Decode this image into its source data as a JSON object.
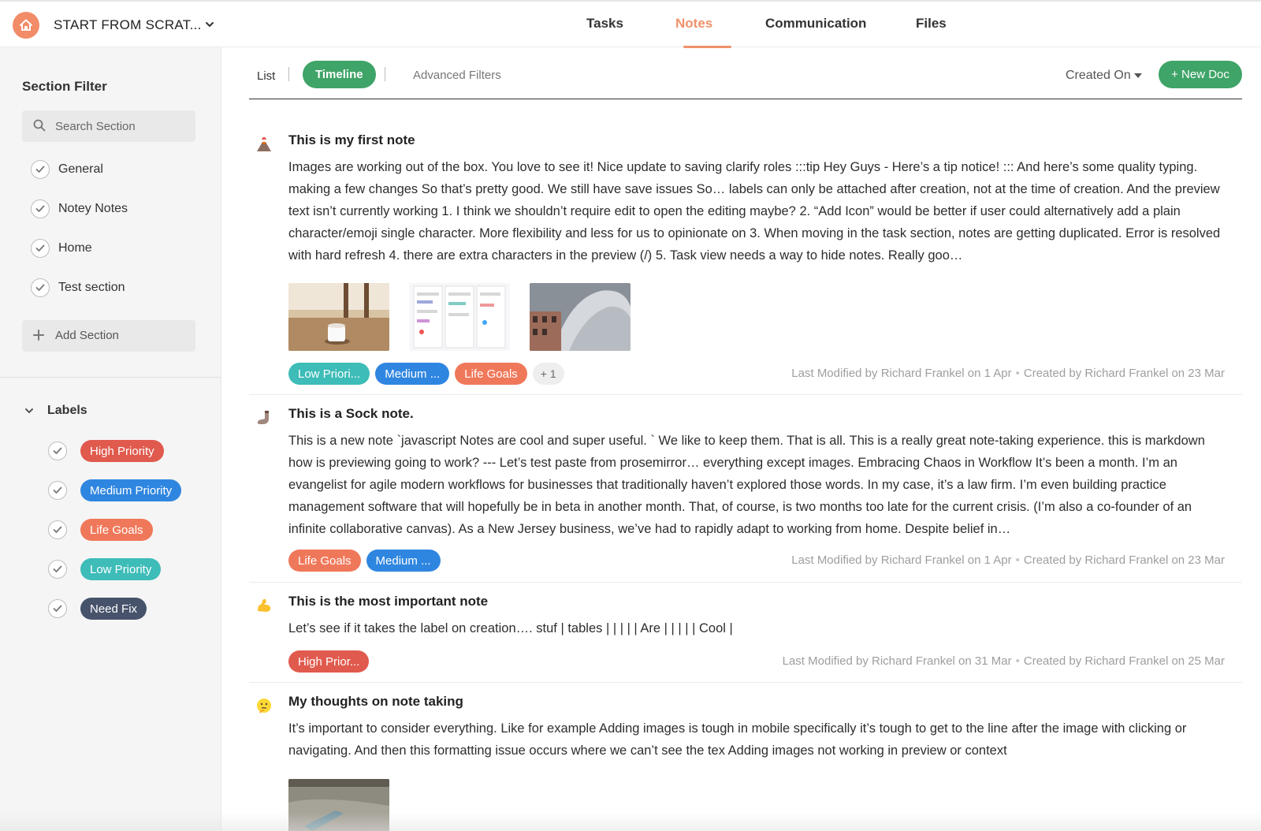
{
  "project": {
    "title": "START FROM SCRAT..."
  },
  "nav": {
    "tabs": [
      {
        "label": "Tasks",
        "active": false
      },
      {
        "label": "Notes",
        "active": true
      },
      {
        "label": "Communication",
        "active": false
      },
      {
        "label": "Files",
        "active": false
      }
    ]
  },
  "sidebar": {
    "section_filter_title": "Section Filter",
    "search_placeholder": "Search Section",
    "sections": [
      "General",
      "Notey Notes",
      "Home",
      "Test section"
    ],
    "add_section_label": "Add Section",
    "labels_title": "Labels",
    "labels": [
      {
        "name": "High Priority",
        "color": "#e05a4e"
      },
      {
        "name": "Medium Priority",
        "color": "#2f86e0"
      },
      {
        "name": "Life Goals",
        "color": "#f0785a"
      },
      {
        "name": "Low Priority",
        "color": "#3dbcb8"
      },
      {
        "name": "Need Fix",
        "color": "#46536a"
      }
    ]
  },
  "toolbar": {
    "list_label": "List",
    "timeline_label": "Timeline",
    "advanced_filters_label": "Advanced Filters",
    "sort_label": "Created On",
    "new_doc_label": "+ New Doc"
  },
  "notes": [
    {
      "icon": "volcano-icon",
      "title": "This is my first note",
      "body": "Images are working out of the box. You love to see it! Nice update to saving clarify roles :::tip Hey Guys - Here’s a tip notice! ::: And here’s some quality typing. making a few changes So that’s pretty good. We still have save issues So… labels can only be attached after creation, not at the time of creation. And the preview text isn’t currently working 1. I think we shouldn’t require edit to open the editing maybe? 2. “Add Icon” would be better if user could alternatively add a plain character/emoji single character. More flexibility and less for us to opinionate on 3. When moving in the task section, notes are getting duplicated. Error is resolved with hard refresh 4. there are extra characters in the preview (/) 5. Task view needs a way to hide notes. Really goo…",
      "images": [
        "coffee-cup-photo",
        "task-board-screenshot",
        "wave-building-photo"
      ],
      "pills": [
        {
          "text": "Low Priori...",
          "color": "#3dbcb8"
        },
        {
          "text": "Medium ...",
          "color": "#2f86e0"
        },
        {
          "text": "Life Goals",
          "color": "#f0785a"
        }
      ],
      "extra_count": "+ 1",
      "modified": "Last Modified by Richard Frankel on 1 Apr",
      "created": "Created by Richard Frankel on 23 Mar"
    },
    {
      "icon": "sock-icon",
      "title": "This is a Sock note.",
      "body": "This is a new note `javascript Notes are cool and super useful. ` We like to keep them. That is all. This is a really great note-taking experience. this is markdown how is previewing going to work? --- Let’s test paste from prosemirror… everything except images. Embracing Chaos in Workflow It’s been a month. I’m an evangelist for agile modern workflows for businesses that traditionally haven’t explored those words. In my case, it’s a law firm. I’m even building practice management software that will hopefully be in beta in another month. That, of course, is two months too late for the current crisis. (I’m also a co-founder of an infinite collaborative canvas). As a New Jersey business, we’ve had to rapidly adapt to working from home. Despite belief in…",
      "pills": [
        {
          "text": "Life Goals",
          "color": "#f0785a"
        },
        {
          "text": "Medium ...",
          "color": "#2f86e0"
        }
      ],
      "modified": "Last Modified by Richard Frankel on 1 Apr",
      "created": "Created by Richard Frankel on 23 Mar"
    },
    {
      "icon": "flexed-biceps-icon",
      "title": "This is the most important note",
      "body": "Let’s see if it takes the label on creation…. stuf | tables | | | | | Are | | | | | Cool |",
      "pills": [
        {
          "text": "High Prior...",
          "color": "#e05a4e"
        }
      ],
      "modified": "Last Modified by Richard Frankel on 31 Mar",
      "created": "Created by Richard Frankel on 25 Mar"
    },
    {
      "icon": "thinking-face-icon",
      "title": "My thoughts on note taking",
      "body": "It’s important to consider everything. Like for example Adding images is tough in mobile specifically it’s tough to get to the line after the image with clicking or navigating. And then this formatting issue occurs where we can’t see the tex Adding images not working in preview or context",
      "images": [
        "pavement-photo"
      ]
    }
  ]
}
